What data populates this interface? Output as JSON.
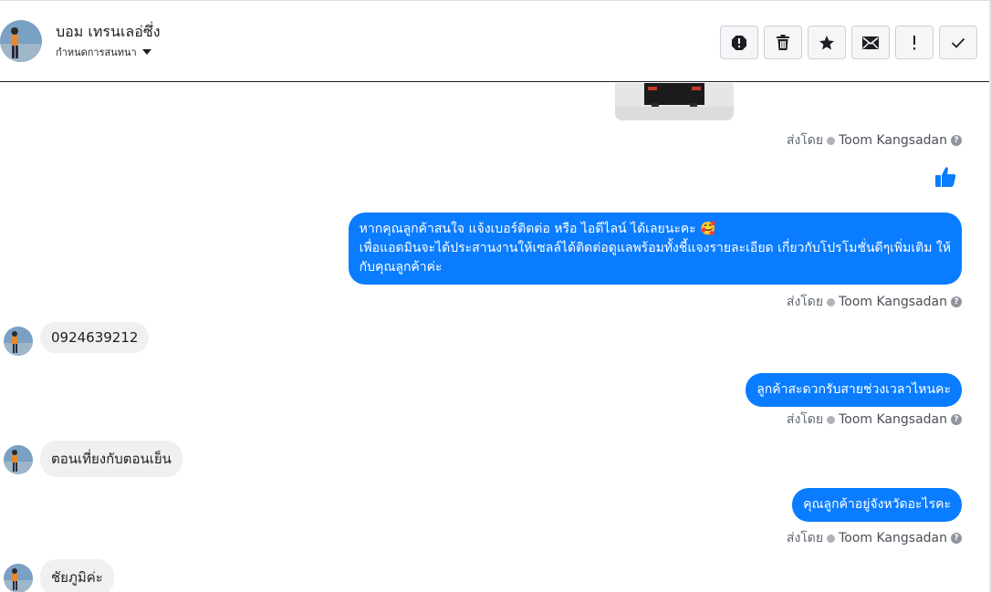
{
  "header": {
    "contact_name": "บอม เทรนเลอ่ซึ่ง",
    "label_select": "กำหนดการสนทนา",
    "toolbar": [
      {
        "name": "mark-spam-icon"
      },
      {
        "name": "delete-icon"
      },
      {
        "name": "star-icon"
      },
      {
        "name": "mark-unread-icon"
      },
      {
        "name": "priority-icon"
      },
      {
        "name": "mark-done-icon"
      }
    ]
  },
  "thread": {
    "sent_by_label": "ส่งโดย",
    "sender_name": "Toom Kangsadan",
    "messages": {
      "out1_line1": "หากคุณลูกค้าสนใจ แจ้งเบอร์ติดต่อ หรือ ไอดีไลน์ ได้เลยนะคะ 🥰",
      "out1_line2": "เพื่อแอดมินจะได้ประสานงานให้เซลล์ได้ติดต่อดูแลพร้อมทั้งชี้แจงรายละเอียด เกี่ยวกับโปรโมชั่นดีๆเพิ่มเติม ให้",
      "out1_line3": "กับคุณลูกค้าค่ะ",
      "in1": "0924639212",
      "out2": "ลูกค้าสะดวกรับสายช่วงเวลาไหนคะ",
      "in2": "ตอนเที่ยงกับตอนเย็น",
      "out3": "คุณลูกค้าอยู่จังหวัดอะไรคะ",
      "in3": "ชัยภูมิค่ะ"
    }
  },
  "colors": {
    "outgoing_bubble": "#0a7cff",
    "incoming_bubble": "#f0f0f0",
    "like_icon": "#0a7cff"
  }
}
